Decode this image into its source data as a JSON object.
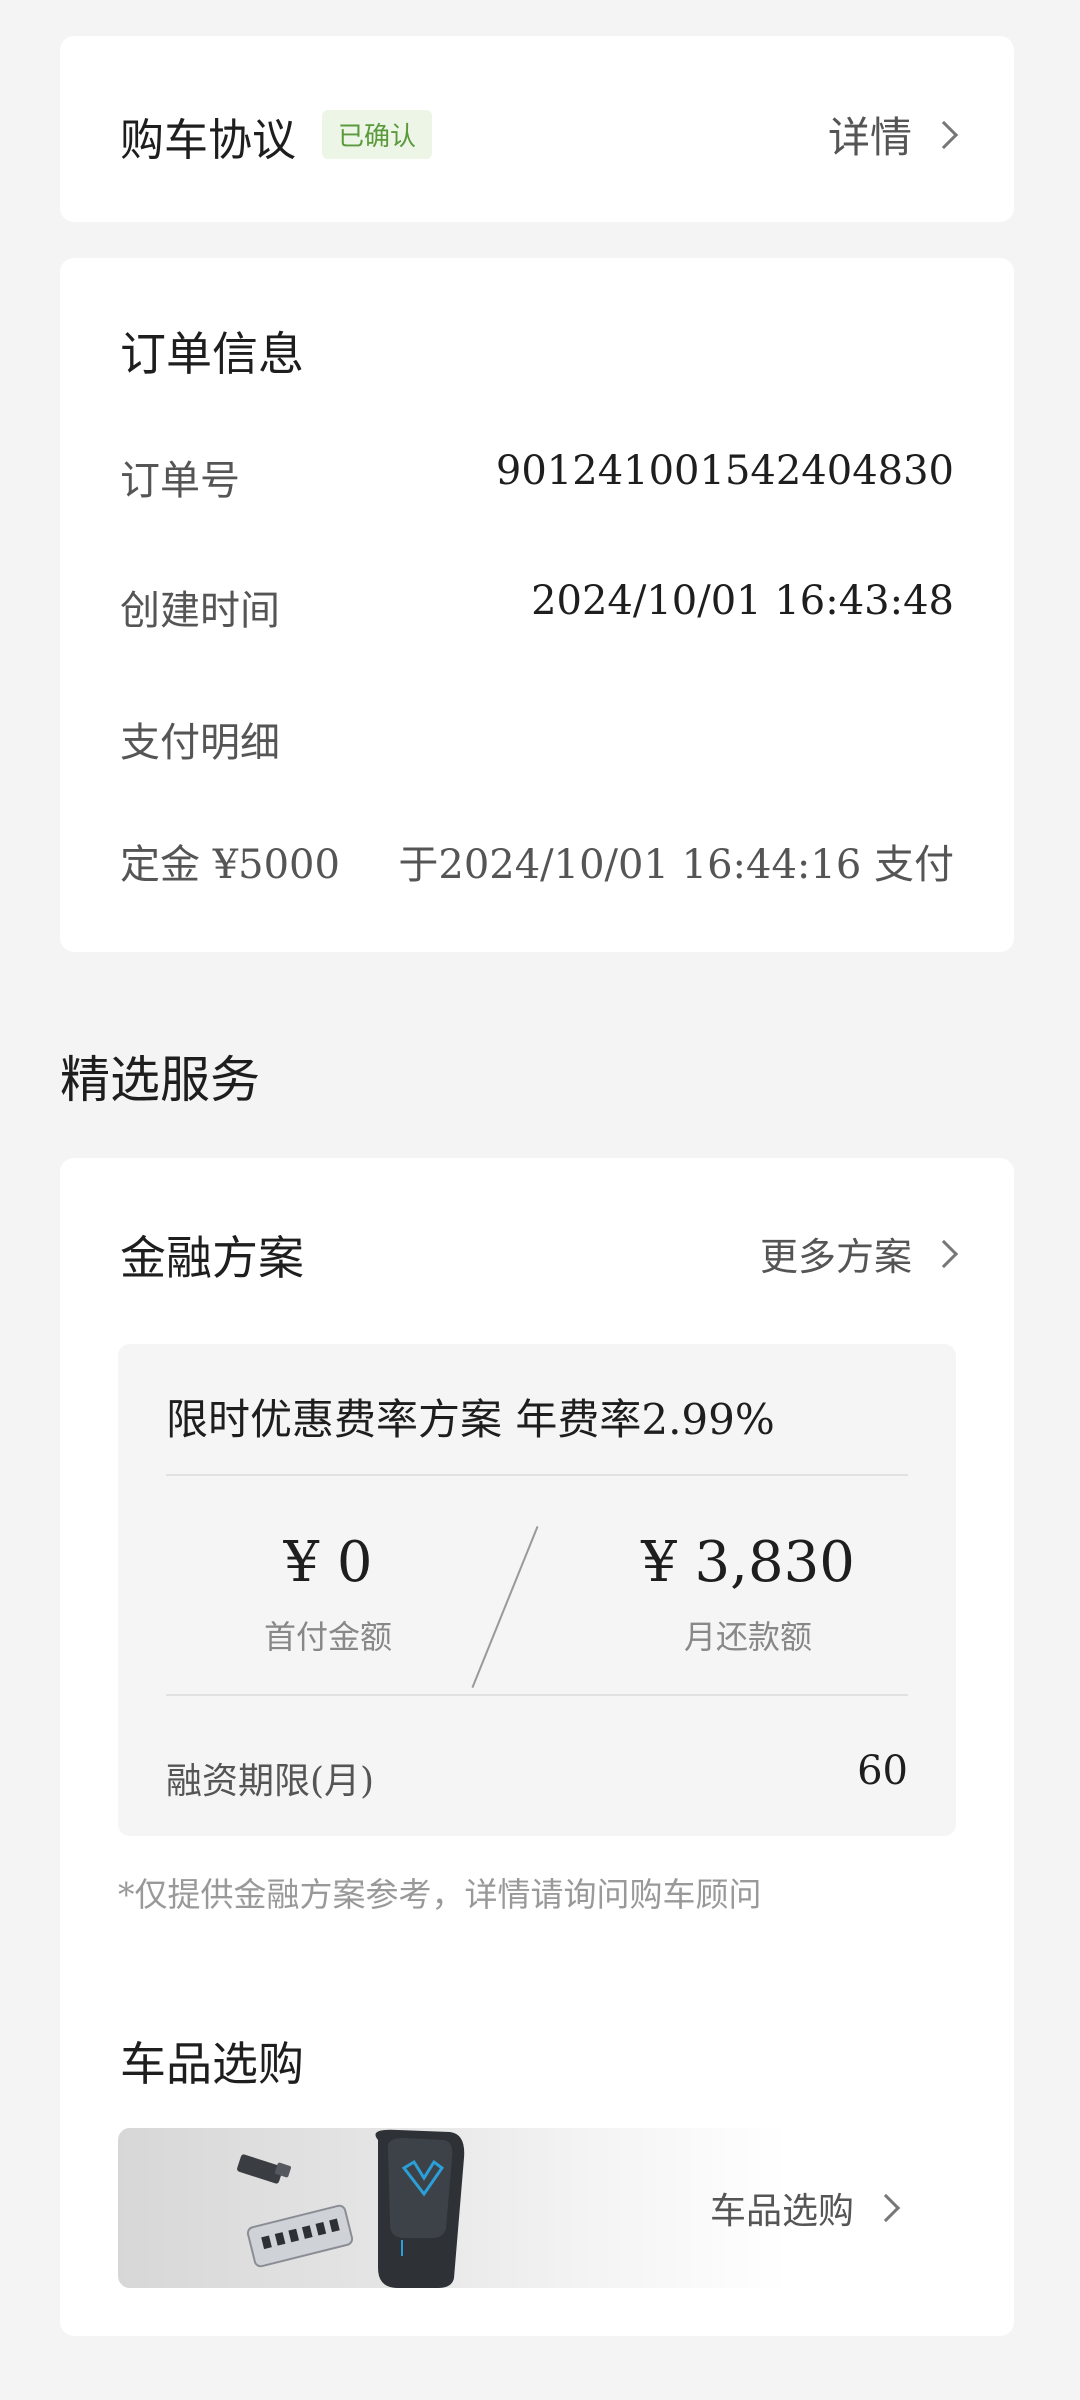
{
  "agreement": {
    "title": "购车协议",
    "badge": "已确认",
    "detail_label": "详情"
  },
  "order": {
    "title": "订单信息",
    "order_no_label": "订单号",
    "order_no": "9012410015424048 30",
    "created_label": "创建时间",
    "created_time": "2024/10/01 16:43:48",
    "payment_label": "支付明细",
    "deposit_label": "定金 ¥5000",
    "deposit_paid": "于2024/10/01 16:44:16 支付"
  },
  "services": {
    "section_title": "精选服务",
    "finance": {
      "title": "金融方案",
      "more_label": "更多方案",
      "plan_name": "限时优惠费率方案 年费率2.99%",
      "down_payment": "¥ 0",
      "down_payment_label": "首付金额",
      "monthly_payment": "¥ 3,830",
      "monthly_payment_label": "月还款额",
      "term_label": "融资期限(月)",
      "term_value": "60",
      "disclaimer": "*仅提供金融方案参考，详情请询问购车顾问"
    },
    "shop": {
      "title": "车品选购",
      "link_label": "车品选购"
    }
  },
  "colors": {
    "background": "#f4f4f4",
    "card": "#ffffff",
    "badge_bg": "#ecf5e6",
    "badge_text": "#5a9a3c",
    "charger_accent": "#2a9fd8"
  },
  "icons": [
    "chevron-right-icon",
    "charger-product-image",
    "adapter-product-image"
  ]
}
